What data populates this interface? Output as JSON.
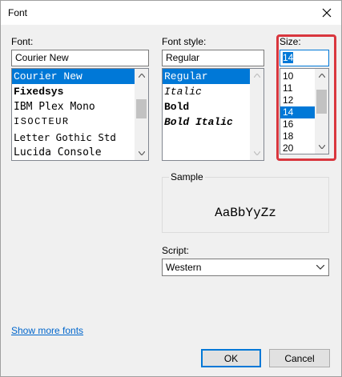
{
  "window": {
    "title": "Font"
  },
  "font": {
    "label": "Font:",
    "value": "Courier New",
    "items": [
      {
        "label": "Courier New",
        "selected": true
      },
      {
        "label": "Fixedsys"
      },
      {
        "label": "IBM Plex Mono"
      },
      {
        "label": "ISOCTEUR"
      },
      {
        "label": "Letter Gothic Std"
      },
      {
        "label": "Lucida Console"
      }
    ]
  },
  "style": {
    "label": "Font style:",
    "value": "Regular",
    "items": [
      {
        "label": "Regular",
        "selected": true
      },
      {
        "label": "Italic"
      },
      {
        "label": "Bold"
      },
      {
        "label": "Bold Italic"
      }
    ]
  },
  "size": {
    "label": "Size:",
    "value": "14",
    "items": [
      "10",
      "11",
      "12",
      "14",
      "16",
      "18",
      "20"
    ],
    "selected": "14"
  },
  "sample": {
    "label": "Sample",
    "text": "AaBbYyZz"
  },
  "script": {
    "label": "Script:",
    "value": "Western"
  },
  "links": {
    "show_more": "Show more fonts"
  },
  "buttons": {
    "ok": "OK",
    "cancel": "Cancel"
  },
  "colors": {
    "accent": "#0078d7",
    "highlight": "#d9363e",
    "link": "#0066cc"
  }
}
